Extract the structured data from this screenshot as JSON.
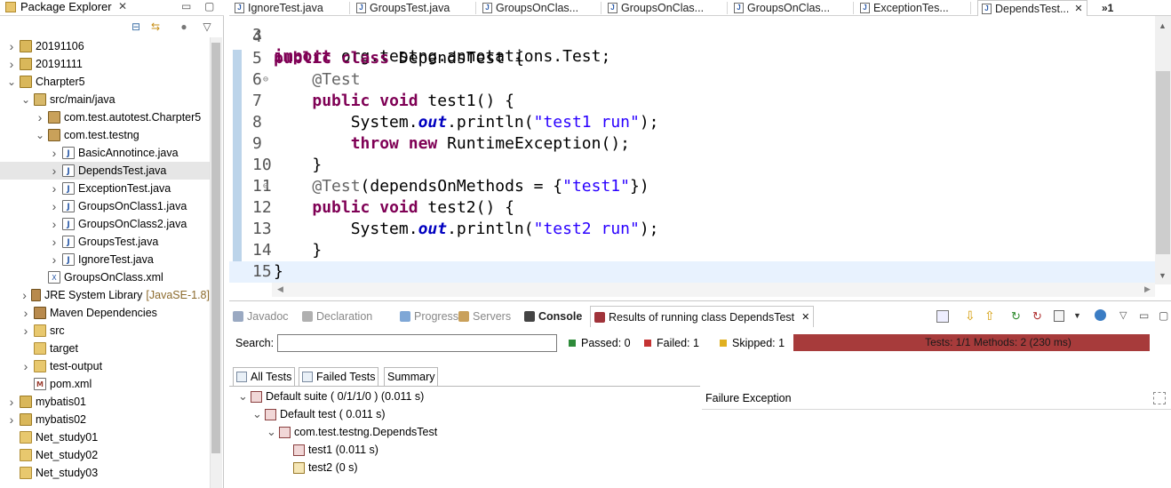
{
  "package_explorer": {
    "title": "Package Explorer",
    "tree": [
      {
        "label": "20191106",
        "icon": "project-icon",
        "expanded": false,
        "level": 0
      },
      {
        "label": "20191111",
        "icon": "project-icon",
        "expanded": false,
        "level": 0
      },
      {
        "label": "Charpter5",
        "icon": "project-icon",
        "expanded": true,
        "level": 0
      },
      {
        "label": "src/main/java",
        "icon": "source-folder-icon",
        "expanded": true,
        "level": 1
      },
      {
        "label": "com.test.autotest.Charpter5",
        "icon": "package-icon",
        "expanded": false,
        "level": 2
      },
      {
        "label": "com.test.testng",
        "icon": "package-icon",
        "expanded": true,
        "level": 2
      },
      {
        "label": "BasicAnnotince.java",
        "icon": "java-file-icon",
        "expanded": false,
        "level": 3
      },
      {
        "label": "DependsTest.java",
        "icon": "java-file-icon",
        "expanded": false,
        "level": 3,
        "selected": true
      },
      {
        "label": "ExceptionTest.java",
        "icon": "java-file-icon",
        "expanded": false,
        "level": 3
      },
      {
        "label": "GroupsOnClass1.java",
        "icon": "java-file-icon",
        "expanded": false,
        "level": 3
      },
      {
        "label": "GroupsOnClass2.java",
        "icon": "java-file-icon",
        "expanded": false,
        "level": 3
      },
      {
        "label": "GroupsTest.java",
        "icon": "java-file-icon",
        "expanded": false,
        "level": 3
      },
      {
        "label": "IgnoreTest.java",
        "icon": "java-file-icon",
        "expanded": false,
        "level": 3
      },
      {
        "label": "GroupsOnClass.xml",
        "icon": "xml-file-icon",
        "expanded": null,
        "level": 2
      },
      {
        "label": "JRE System Library",
        "suffix": "[JavaSE-1.8]",
        "icon": "library-icon",
        "expanded": false,
        "level": 1
      },
      {
        "label": "Maven Dependencies",
        "icon": "library-icon",
        "expanded": false,
        "level": 1
      },
      {
        "label": "src",
        "icon": "folder-icon",
        "expanded": false,
        "level": 1
      },
      {
        "label": "target",
        "icon": "folder-icon",
        "expanded": null,
        "level": 1
      },
      {
        "label": "test-output",
        "icon": "folder-icon",
        "expanded": false,
        "level": 1
      },
      {
        "label": "pom.xml",
        "icon": "pom-file-icon",
        "expanded": null,
        "level": 1
      },
      {
        "label": "mybatis01",
        "icon": "project-icon",
        "expanded": false,
        "level": 0
      },
      {
        "label": "mybatis02",
        "icon": "project-icon",
        "expanded": false,
        "level": 0
      },
      {
        "label": "Net_study01",
        "icon": "folder-icon",
        "expanded": null,
        "level": 0
      },
      {
        "label": "Net_study02",
        "icon": "folder-icon",
        "expanded": null,
        "level": 0
      },
      {
        "label": "Net_study03",
        "icon": "folder-icon",
        "expanded": null,
        "level": 0
      }
    ]
  },
  "editor_tabs": [
    {
      "label": "IgnoreTest.java"
    },
    {
      "label": "GroupsTest.java"
    },
    {
      "label": "GroupsOnClas..."
    },
    {
      "label": "GroupsOnClas..."
    },
    {
      "label": "GroupsOnClas..."
    },
    {
      "label": "ExceptionTes..."
    },
    {
      "label": "DependsTest...",
      "active": true
    }
  ],
  "editor_overflow": "»1",
  "code": {
    "partial_top_line": "import org.testng.annotations.Test;",
    "lines": [
      {
        "no": "4",
        "html": ""
      },
      {
        "no": "5",
        "tokens": [
          [
            "kw",
            "public"
          ],
          [
            "t",
            " "
          ],
          [
            "kw",
            "class"
          ],
          [
            "t",
            " DependsTest {"
          ]
        ]
      },
      {
        "no": "6",
        "fold": true,
        "tokens": [
          [
            "t",
            "    "
          ],
          [
            "ann",
            "@Test"
          ]
        ]
      },
      {
        "no": "7",
        "tokens": [
          [
            "t",
            "    "
          ],
          [
            "kw",
            "public"
          ],
          [
            "t",
            " "
          ],
          [
            "kw",
            "void"
          ],
          [
            "t",
            " test1() {"
          ]
        ]
      },
      {
        "no": "8",
        "tokens": [
          [
            "t",
            "        System."
          ],
          [
            "fld",
            "out"
          ],
          [
            "t",
            ".println("
          ],
          [
            "str",
            "\"test1 run\""
          ],
          [
            "t",
            ");"
          ]
        ]
      },
      {
        "no": "9",
        "tokens": [
          [
            "t",
            "        "
          ],
          [
            "kw",
            "throw"
          ],
          [
            "t",
            " "
          ],
          [
            "kw",
            "new"
          ],
          [
            "t",
            " RuntimeException();"
          ]
        ]
      },
      {
        "no": "10",
        "tokens": [
          [
            "t",
            "    }"
          ]
        ]
      },
      {
        "no": "11",
        "fold": true,
        "tokens": [
          [
            "t",
            "    "
          ],
          [
            "ann",
            "@Test"
          ],
          [
            "t",
            "(dependsOnMethods = {"
          ],
          [
            "str",
            "\"test1\""
          ],
          [
            "t",
            "})"
          ]
        ]
      },
      {
        "no": "12",
        "tokens": [
          [
            "t",
            "    "
          ],
          [
            "kw",
            "public"
          ],
          [
            "t",
            " "
          ],
          [
            "kw",
            "void"
          ],
          [
            "t",
            " test2() {"
          ]
        ]
      },
      {
        "no": "13",
        "tokens": [
          [
            "t",
            "        System."
          ],
          [
            "fld",
            "out"
          ],
          [
            "t",
            ".println("
          ],
          [
            "str",
            "\"test2 run\""
          ],
          [
            "t",
            ");"
          ]
        ]
      },
      {
        "no": "14",
        "tokens": [
          [
            "t",
            "    }"
          ]
        ]
      },
      {
        "no": "15",
        "current": true,
        "tokens": [
          [
            "t",
            "}"
          ]
        ]
      }
    ]
  },
  "bottom_tabs": [
    {
      "label": "Javadoc"
    },
    {
      "label": "Declaration"
    },
    {
      "label": "Progress"
    },
    {
      "label": "Servers"
    },
    {
      "label": "Console",
      "bold": true
    },
    {
      "label": "Results of running class DependsTest",
      "active": true
    }
  ],
  "results": {
    "search_label": "Search:",
    "search_value": "",
    "passed": "Passed: 0",
    "failed": "Failed: 1",
    "skipped": "Skipped: 1",
    "summary_bar": "Tests: 1/1  Methods: 2 (230 ms)",
    "sub_tabs": [
      "All Tests",
      "Failed Tests",
      "Summary"
    ],
    "tree": [
      {
        "label": "Default suite ( 0/1/1/0 ) (0.011 s)",
        "level": 0,
        "status": "failed"
      },
      {
        "label": "Default test ( 0.011 s)",
        "level": 1,
        "status": "failed"
      },
      {
        "label": "com.test.testng.DependsTest",
        "level": 2,
        "status": "failed"
      },
      {
        "label": "test1  (0.011 s)",
        "level": 3,
        "status": "failed"
      },
      {
        "label": "test2  (0 s)",
        "level": 3,
        "status": "skipped"
      }
    ],
    "failure_title": "Failure Exception"
  },
  "colors": {
    "keyword": "#7f0055",
    "string": "#2a00ff",
    "annotation": "#646464",
    "failed_bar": "#a73b3b"
  }
}
